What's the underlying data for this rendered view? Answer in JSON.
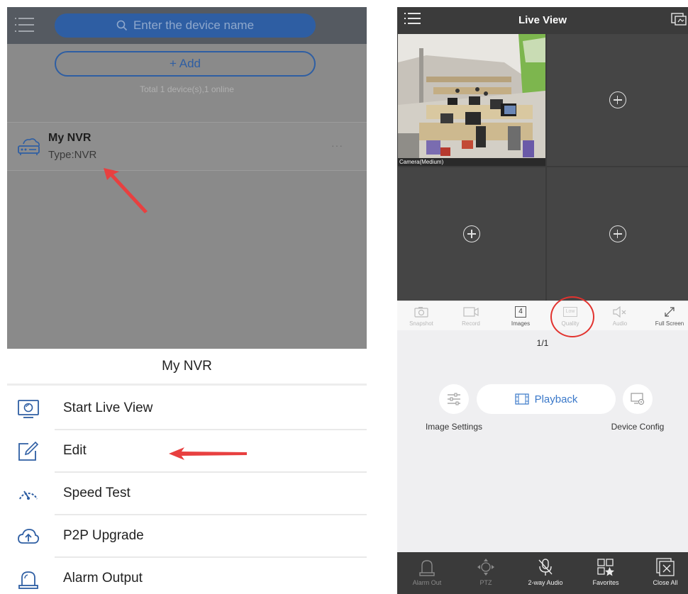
{
  "left_screen": {
    "search": {
      "placeholder": "Enter the device name"
    },
    "add_button": {
      "label": "+ Add"
    },
    "device_total": "Total 1 device(s),1 online",
    "device": {
      "name": "My NVR",
      "type": "Type:NVR",
      "more": "···"
    },
    "action_sheet": {
      "title": "My NVR",
      "items": [
        {
          "label": "Start Live View",
          "icon": "monitor-icon"
        },
        {
          "label": "Edit",
          "icon": "edit-icon"
        },
        {
          "label": "Speed Test",
          "icon": "speed-gauge-icon"
        },
        {
          "label": "P2P Upgrade",
          "icon": "cloud-upload-icon"
        },
        {
          "label": "Alarm Output",
          "icon": "alarm-light-icon"
        }
      ]
    }
  },
  "right_screen": {
    "title": "Live View",
    "camera_label": "Camera(Medium)",
    "toolbar": [
      {
        "label": "Snapshot",
        "icon": "camera-icon"
      },
      {
        "label": "Record",
        "icon": "video-record-icon"
      },
      {
        "label": "Images",
        "icon": "grid-count-icon",
        "value": "4"
      },
      {
        "label": "Quality",
        "icon": "quality-badge-icon",
        "value": "Low"
      },
      {
        "label": "Audio",
        "icon": "speaker-mute-icon"
      },
      {
        "label": "Full Screen",
        "icon": "expand-icon"
      }
    ],
    "page_indicator": "1/1",
    "playback_label": "Playback",
    "image_settings_label": "Image Settings",
    "device_config_label": "Device Config",
    "bottom_nav": [
      {
        "label": "Alarm Out",
        "icon": "alarm-light-icon"
      },
      {
        "label": "PTZ",
        "icon": "ptz-icon"
      },
      {
        "label": "2-way Audio",
        "icon": "microphone-muted-icon"
      },
      {
        "label": "Favorites",
        "icon": "favorites-icon"
      },
      {
        "label": "Close All",
        "icon": "close-all-icon"
      }
    ]
  },
  "colors": {
    "brand_blue": "#2e5ea3",
    "highlight_red": "#e2332f",
    "dark_bar": "#3b3b3b"
  }
}
